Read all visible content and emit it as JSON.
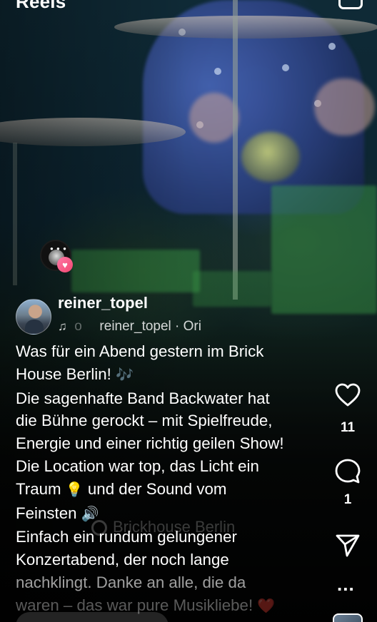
{
  "header": {
    "title": "Reels",
    "camera_icon": "camera-icon"
  },
  "music_avatar": {
    "icon": "music-avatar",
    "badge_icon": "heart-icon"
  },
  "author": {
    "username": "reiner_topel",
    "audio_prefix": "o",
    "audio_text": "reiner_topel · Ori"
  },
  "caption": {
    "lines": [
      "Was für ein Abend gestern im Brick",
      "House Berlin! ",
      "Die sagenhafte Band Backwater hat",
      "die Bühne gerockt – mit Spielfreude,",
      "Energie und einer richtig geilen Show!",
      "Die Location war top, das Licht ein",
      "Traum ",
      " und der Sound vom",
      "Feinsten ",
      "Einfach ein rundum gelungener",
      "Konzertabend, der noch lange",
      "nachklingt. Danke an alle, die da",
      "waren – das war pure Musikliebe! "
    ],
    "emojis": {
      "notes": "🎶",
      "bulb": "💡",
      "speaker": "🔊",
      "heart": "❤️"
    }
  },
  "location": "Brickhouse Berlin",
  "actions": {
    "like_count": "11",
    "comment_count": "1",
    "more_label": "..."
  },
  "colors": {
    "heart_badge": "#f2456f",
    "text": "#ffffff"
  }
}
